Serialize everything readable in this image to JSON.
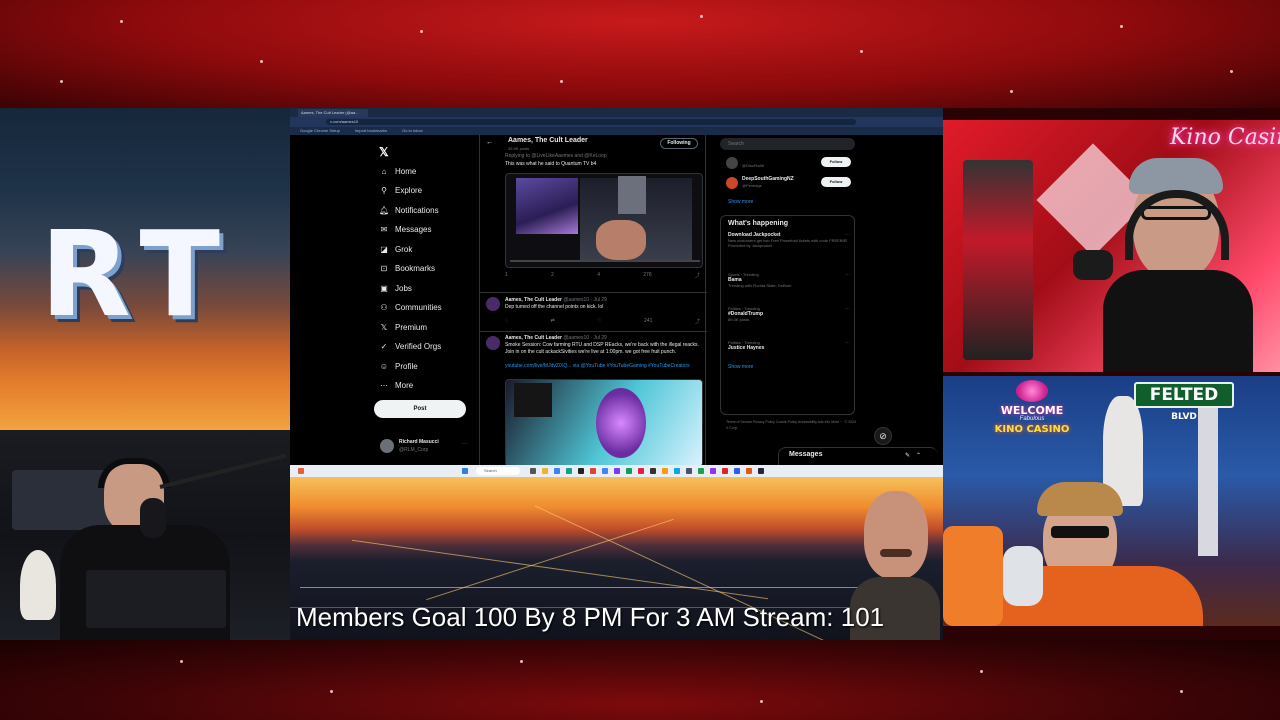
{
  "overlay": {
    "logo_text": "RT",
    "ticker_text": "Members Goal 100 By 8 PM For 3 AM Stream: 101",
    "neon_sign": "Kino Casino",
    "welcome_sign": {
      "line1": "WELCOME",
      "line2": "Fabulous",
      "line3": "KINO CASINO"
    },
    "street_sign": {
      "name": "FELTED",
      "suffix": "BLVD"
    }
  },
  "browser": {
    "tab_title": "Aames, The Cult Leader (@aa...",
    "url": "x.com/aames10",
    "bookmarks": [
      "Google Chrome Setup",
      "Import bookmarks",
      "Go to Inbox"
    ]
  },
  "x_app": {
    "logo": "𝕏",
    "nav": [
      {
        "label": "Home",
        "icon": "⌂"
      },
      {
        "label": "Explore",
        "icon": "⚲"
      },
      {
        "label": "Notifications",
        "icon": "🔔︎"
      },
      {
        "label": "Messages",
        "icon": "✉"
      },
      {
        "label": "Grok",
        "icon": "◪"
      },
      {
        "label": "Bookmarks",
        "icon": "⊡"
      },
      {
        "label": "Jobs",
        "icon": "▣"
      },
      {
        "label": "Communities",
        "icon": "⚇"
      },
      {
        "label": "Premium",
        "icon": "𝕏"
      },
      {
        "label": "Verified Orgs",
        "icon": "✓"
      },
      {
        "label": "Profile",
        "icon": "☺"
      },
      {
        "label": "More",
        "icon": "⋯"
      }
    ],
    "post_button": "Post",
    "account": {
      "name": "Richard Masucci",
      "handle": "@RLM_Corp",
      "more": "···"
    },
    "profile": {
      "name": "Aames, The Cult Leader",
      "posts": "35.9K posts",
      "follow_state": "Following"
    },
    "tweets": [
      {
        "author": "",
        "meta": "Replying to @LiveLikeAaemes and @KeLoop",
        "text": "This was what he said to Quantum TV b4",
        "actions": [
          "1",
          "2",
          "4",
          "278",
          ""
        ]
      },
      {
        "author": "Aames, The Cult Leader",
        "meta": "@aames10 · Jul 29",
        "text": "Dep turned off the channel points on kick. lol",
        "actions": [
          "",
          "",
          "",
          "241",
          ""
        ]
      },
      {
        "author": "Aames, The Cult Leader",
        "meta": "@aames10 · Jul 29",
        "text": "Smoke Session: Cow farming RTU and DSP REacks, we're back with the illegal reacks. Join in on the cult ackackSivities we're live at 1:00pm. we got free fruit punch.",
        "link": "youtube.com/live/MJdvZiXQ... via @YouTube #YouTubeGaming #YouTubeCreators"
      }
    ],
    "sidebar": {
      "search_placeholder": "Search",
      "suggestions": [
        {
          "name": "",
          "handle": "@DiscFlo88",
          "button": "Follow"
        },
        {
          "name": "DeepSouthGamingNZ",
          "handle": "@Pevedgs",
          "button": "Follow"
        }
      ],
      "show_more": "Show more",
      "whats_happening": "What's happening",
      "trends": [
        {
          "category": "Download Jackpocket",
          "title": "",
          "count": "New customers get two Free Powerball tickets with code FREEBIE!",
          "extra": "Promoted by Jackpocket"
        },
        {
          "category": "Sports · Trending",
          "title": "Bama",
          "count": "Trending with Florida State, DeBoer"
        },
        {
          "category": "Politics · Trending",
          "title": "#DonaldTrump",
          "count": "89.3K posts"
        },
        {
          "category": "Politics · Trending",
          "title": "Justice Haynes",
          "count": ""
        }
      ],
      "show_more_2": "Show more",
      "footer": "Terms of Service  Privacy Policy  Cookie Policy  Accessibility  Ads info  More ···  © 2024 X Corp."
    },
    "messages_label": "Messages"
  },
  "taskbar": {
    "search_label": "Search"
  },
  "colors": {
    "x_bg": "#000000",
    "x_link": "#1d9bf0",
    "ticker_text": "#ffffff",
    "neon_pink": "#ff3fb0"
  }
}
